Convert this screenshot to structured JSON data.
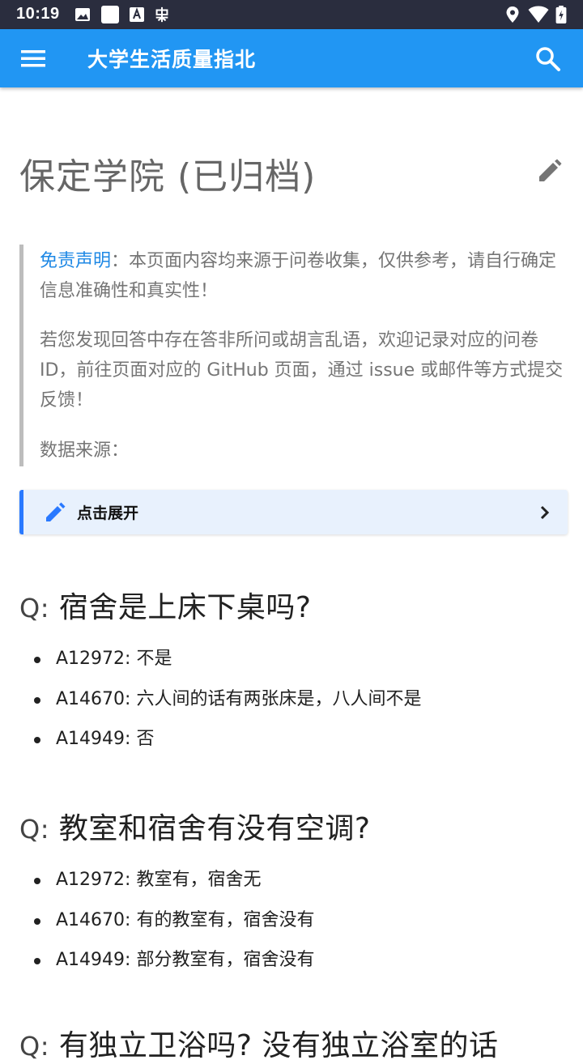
{
  "status_bar": {
    "time": "10:19",
    "left_icons": [
      "image-icon",
      "square-icon",
      "a-icon",
      "bug-icon"
    ],
    "right_icons": [
      "location-icon",
      "wifi-icon",
      "battery-icon"
    ]
  },
  "appbar": {
    "title": "大学生活质量指北",
    "menu_icon": "menu-icon",
    "search_icon": "search-icon"
  },
  "page": {
    "title": "保定学院 (已归档)",
    "edit_icon": "edit-icon"
  },
  "disclaimer": {
    "link": "免责声明",
    "p1_rest": "：本页面内容均来源于问卷收集，仅供参考，请自行确定信息准确性和真实性！",
    "p2": "若您发现回答中存在答非所问或胡言乱语，欢迎记录对应的问卷 ID，前往页面对应的 GitHub 页面，通过 issue 或邮件等方式提交反馈！",
    "p3": "数据来源："
  },
  "expand": {
    "label": "点击展开"
  },
  "questions": [
    {
      "prefix": "Q:",
      "text": "宿舍是上床下桌吗?",
      "answers": [
        "A12972: 不是",
        "A14670: 六人间的话有两张床是，八人间不是",
        "A14949: 否"
      ]
    },
    {
      "prefix": "Q:",
      "text": "教室和宿舍有没有空调?",
      "answers": [
        "A12972: 教室有，宿舍无",
        "A14670: 有的教室有，宿舍没有",
        "A14949: 部分教室有，宿舍没有"
      ]
    },
    {
      "prefix": "Q:",
      "text": "有独立卫浴吗? 没有独立浴室的话",
      "answers": []
    }
  ],
  "colors": {
    "appbar": "#2196f3",
    "statusbar": "#2a2d3e",
    "link": "#1e88e5",
    "admon_border": "#2979ff"
  }
}
